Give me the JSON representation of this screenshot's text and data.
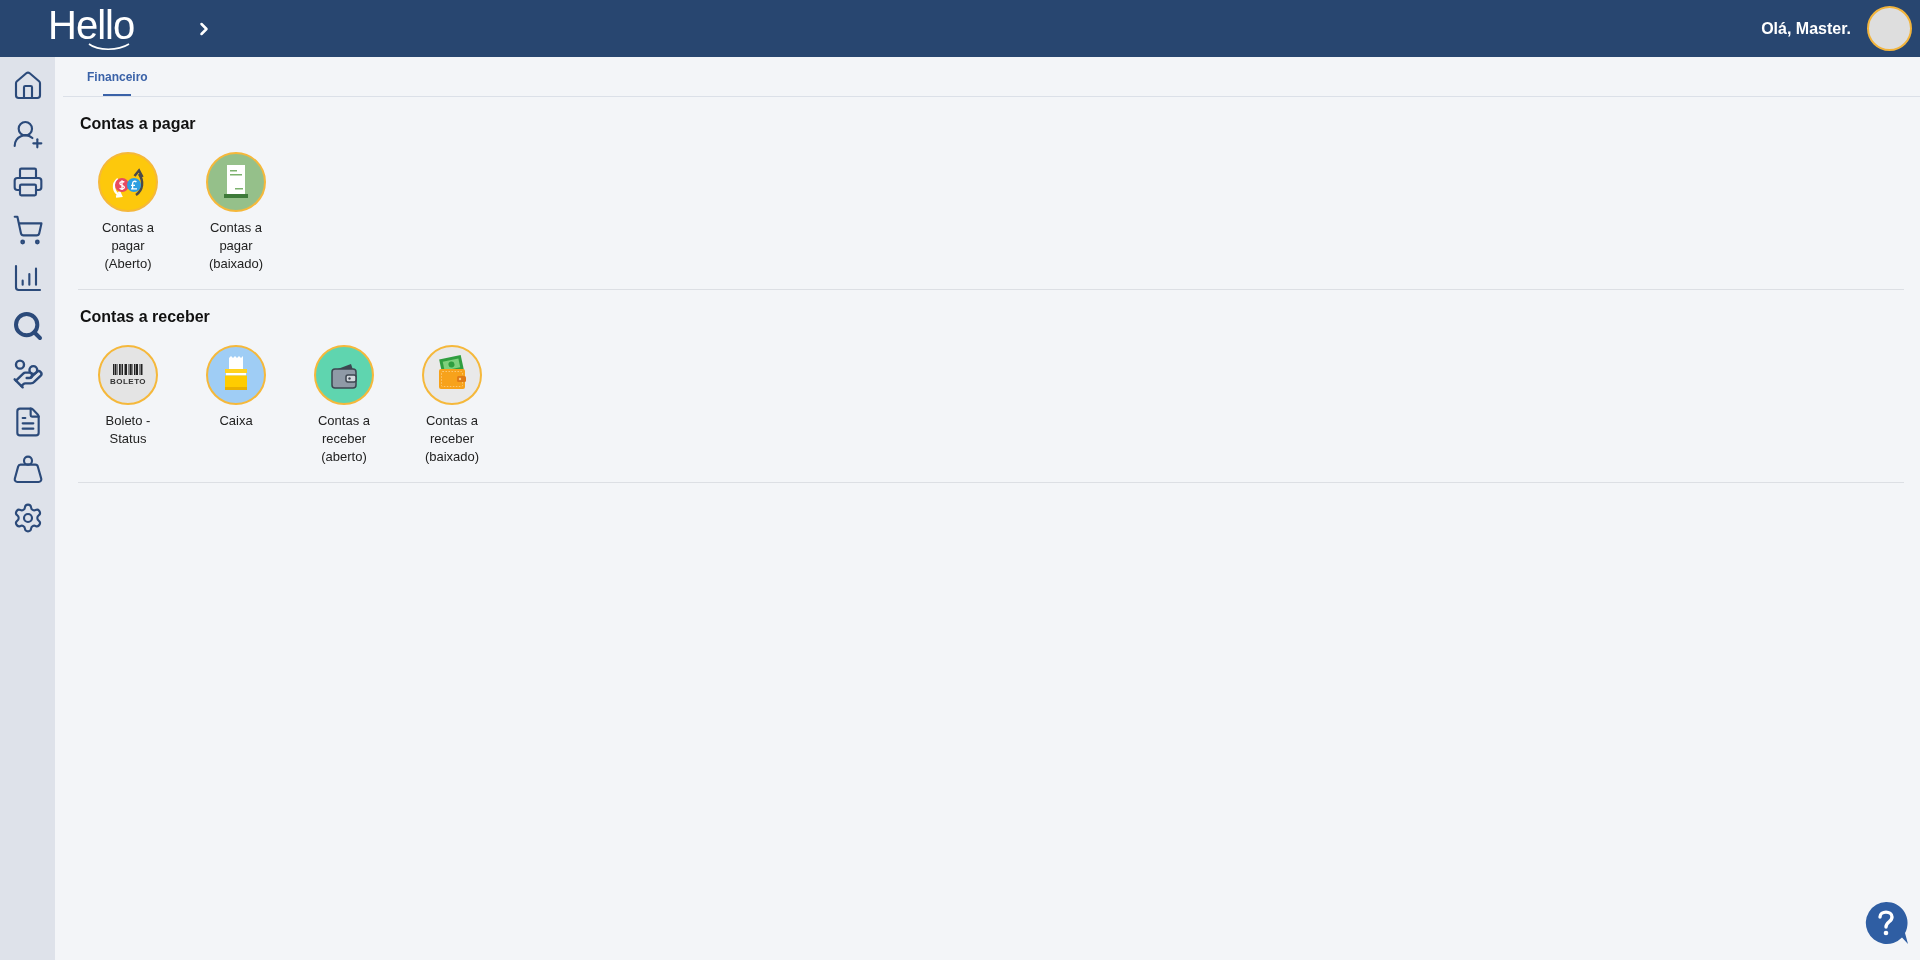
{
  "header": {
    "logo": "Hello",
    "greeting": "Olá, Master."
  },
  "tabs": [
    {
      "label": "Financeiro",
      "selected": true
    }
  ],
  "sections": [
    {
      "title": "Contas a pagar",
      "items": [
        {
          "label": "Contas a pagar (Aberto)",
          "kind": "exchange"
        },
        {
          "label": "Contas a pagar (baixado)",
          "kind": "receipt"
        }
      ]
    },
    {
      "title": "Contas a receber",
      "items": [
        {
          "label": "Boleto - Status",
          "kind": "boleto",
          "icon_text": "BOLETO"
        },
        {
          "label": "Caixa",
          "kind": "register"
        },
        {
          "label": "Contas a receber (aberto)",
          "kind": "wallet"
        },
        {
          "label": "Contas a receber (baixado)",
          "kind": "cash-wallet"
        }
      ]
    }
  ]
}
